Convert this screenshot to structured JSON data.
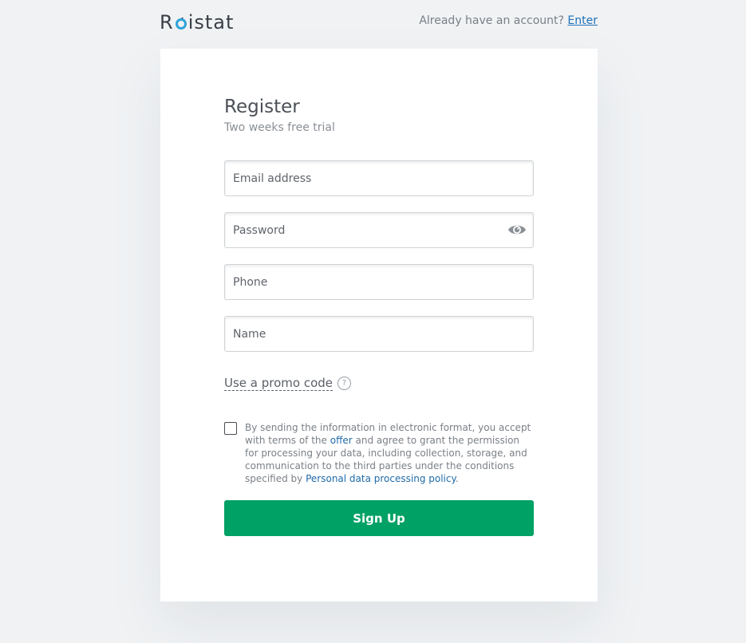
{
  "header": {
    "logo_prefix": "R",
    "logo_suffix": "istat",
    "login_prompt": "Already have an account?",
    "login_link": "Enter"
  },
  "form": {
    "title": "Register",
    "subtitle": "Two weeks free trial",
    "email_placeholder": "Email address",
    "password_placeholder": "Password",
    "phone_placeholder": "Phone",
    "name_placeholder": "Name",
    "promo_label": "Use a promo code",
    "help_symbol": "?",
    "consent": {
      "part1": "By sending the information in electronic format, you accept with terms of the ",
      "offer_link": "offer",
      "part2": " and agree to grant the permission for processing your data, including collection, storage, and communication to the third parties under the conditions specified by ",
      "policy_link": "Personal data processing policy",
      "part3": "."
    },
    "submit_label": "Sign Up"
  },
  "icons": {
    "logo_o": "logo-ring-icon",
    "password_toggle": "eye-icon",
    "promo_help": "question-circle-icon"
  },
  "colors": {
    "accent_green": "#00a165",
    "link_blue": "#1f72b8",
    "logo_blue": "#2ea3dc",
    "background": "#f0f2f4"
  }
}
